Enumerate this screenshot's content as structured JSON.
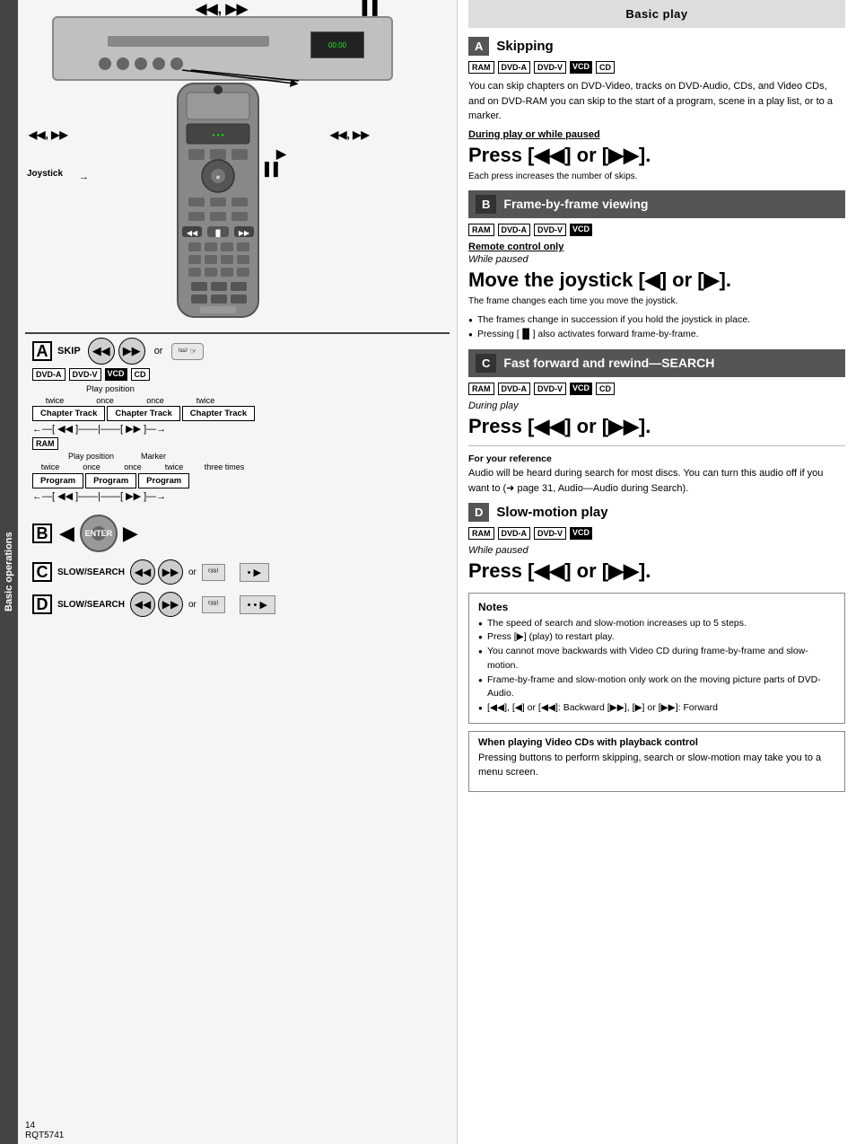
{
  "page": {
    "title": "Basic play",
    "page_number": "14",
    "product_code": "RQT5741"
  },
  "sidebar": {
    "label": "Basic operations"
  },
  "sections": {
    "A": {
      "letter": "A",
      "title": "Skipping",
      "badges": [
        "RAM",
        "DVD-A",
        "DVD-V",
        "VCD",
        "CD"
      ],
      "body": "You can skip chapters on DVD-Video, tracks on DVD-Audio, CDs, and Video CDs, and on DVD-RAM you can skip to the start of a program, scene in a play list, or to a marker.",
      "during_play_label": "During play or while paused",
      "instruction": "Press [◀◀] or [▶▶].",
      "sub_note": "Each press increases the number of skips."
    },
    "B": {
      "letter": "B",
      "title": "Frame-by-frame viewing",
      "badges": [
        "RAM",
        "DVD-A",
        "DVD-V",
        "VCD"
      ],
      "remote_note": "Remote control only",
      "while_paused": "While paused",
      "instruction": "Move the joystick [◀] or [▶].",
      "sub_note": "The frame changes each time you move the joystick.",
      "bullets": [
        "The frames change in succession if you hold the joystick in place.",
        "Pressing [▐▌] also activates forward frame-by-frame."
      ]
    },
    "C": {
      "letter": "C",
      "title": "Fast forward and rewind—SEARCH",
      "badges": [
        "RAM",
        "DVD-A",
        "DVD-V",
        "VCD",
        "CD"
      ],
      "during_play": "During play",
      "instruction": "Press [◀◀] or [▶▶].",
      "for_ref": "For your reference",
      "for_ref_body": "Audio will be heard during search for most discs. You can turn this audio off if you want to (➜ page 31, Audio—Audio during Search)."
    },
    "D": {
      "letter": "D",
      "title": "Slow-motion play",
      "badges": [
        "RAM",
        "DVD-A",
        "DVD-V",
        "VCD"
      ],
      "while_paused": "While paused",
      "instruction": "Press [◀◀] or [▶▶]."
    }
  },
  "notes": {
    "title": "Notes",
    "items": [
      "The speed of search and slow-motion increases up to 5 steps.",
      "Press [▶] (play) to restart play.",
      "You cannot move backwards with Video CD during frame-by-frame and slow-motion.",
      "Frame-by-frame and slow-motion only work on the moving picture parts of DVD-Audio.",
      "[◀◀], [◀] or [◀◀]:  Backward     [▶▶], [▶] or [▶▶]:  Forward"
    ]
  },
  "vcd_box": {
    "title": "When playing Video CDs with playback control",
    "body": "Pressing buttons to perform skipping, search or slow-motion may take you to a menu screen."
  },
  "left_diagrams": {
    "skip_label": "SKIP",
    "or_text": "or",
    "chapter_track_label": "Chapter Track",
    "chapter_track_label2": "Chapter Track",
    "chapter_track_label3": "Chapter Track",
    "play_position": "Play position",
    "twice": "twice",
    "once": "once",
    "once2": "once",
    "twice2": "twice",
    "ram_label": "RAM",
    "program": "Program",
    "program2": "Program",
    "program3": "Program",
    "marker": "Marker",
    "three_times": "three times",
    "dvd_a": "DVD-A",
    "dvd_v": "DVD-V",
    "vcd_badge": "VCD",
    "cd_badge": "CD",
    "slow_search": "SLOW/SEARCH",
    "joystick_label": "Joystick"
  }
}
